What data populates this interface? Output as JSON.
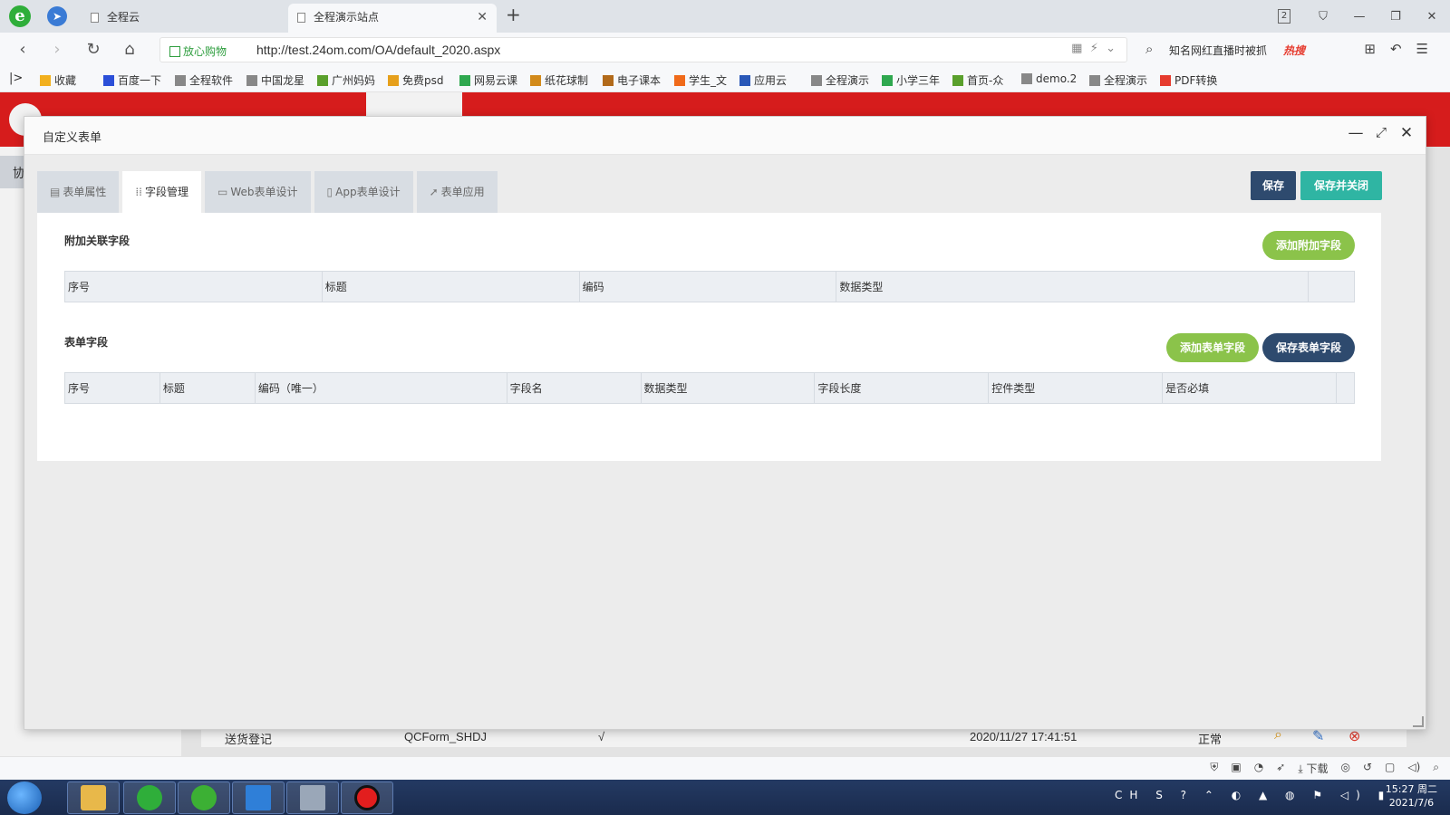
{
  "browser": {
    "tabs": [
      {
        "title": "全程云"
      },
      {
        "title": "全程演示站点"
      }
    ],
    "tab_count_badge": "2",
    "address": {
      "secure_label": "放心购物",
      "url": "http://test.24om.com/OA/default_2020.aspx"
    },
    "search": {
      "hint": "知名网红直播时被抓",
      "hot_label": "热搜"
    },
    "bookmarks": [
      {
        "label": "收藏",
        "icon": "star-icon",
        "color": "#f2b01e"
      },
      {
        "label": "百度一下",
        "icon": "baidu-icon",
        "color": "#2b4fd8"
      },
      {
        "label": "全程软件",
        "icon": "page-icon",
        "color": "#888888"
      },
      {
        "label": "中国龙星",
        "icon": "page-icon",
        "color": "#888888"
      },
      {
        "label": "广州妈妈",
        "icon": "leaf-icon",
        "color": "#5aa02c"
      },
      {
        "label": "免费psd",
        "icon": "eye-icon",
        "color": "#e6a01c"
      },
      {
        "label": "网易云课",
        "icon": "book-icon",
        "color": "#2fa84f"
      },
      {
        "label": "纸花球制",
        "icon": "globe-icon",
        "color": "#d28a1a"
      },
      {
        "label": "电子课本",
        "icon": "book-icon",
        "color": "#b26a1a"
      },
      {
        "label": "学生_文",
        "icon": "90-icon",
        "color": "#f06a1a"
      },
      {
        "label": "应用云",
        "icon": "cloud-icon",
        "color": "#2a58b8"
      },
      {
        "label": "全程演示",
        "icon": "page-icon",
        "color": "#888888"
      },
      {
        "label": "小学三年",
        "icon": "book-icon",
        "color": "#2fa84f"
      },
      {
        "label": "首页-众",
        "icon": "pen-icon",
        "color": "#5aa02c"
      },
      {
        "label": "demo.2",
        "icon": "page-icon",
        "color": "#888888"
      },
      {
        "label": "全程演示",
        "icon": "page-icon",
        "color": "#888888"
      },
      {
        "label": "PDF转换",
        "icon": "pdf-icon",
        "color": "#e63b2e"
      }
    ],
    "status_items": [
      "下载"
    ]
  },
  "background_row": {
    "name": "送货登记",
    "code": "QCForm_SHDJ",
    "check": "√",
    "datetime": "2020/11/27 17:41:51",
    "status": "正常"
  },
  "modal": {
    "title": "自定义表单",
    "tabs": [
      {
        "label": "表单属性",
        "icon": "document-icon",
        "glyph": "▤"
      },
      {
        "label": "字段管理",
        "icon": "grid-dots-icon",
        "glyph": "⁞⁞"
      },
      {
        "label": "Web表单设计",
        "icon": "monitor-icon",
        "glyph": "▭"
      },
      {
        "label": "App表单设计",
        "icon": "phone-icon",
        "glyph": "▯"
      },
      {
        "label": "表单应用",
        "icon": "paper-plane-icon",
        "glyph": "➚"
      }
    ],
    "active_tab": "字段管理",
    "buttons": {
      "save": "保存",
      "save_close": "保存并关闭"
    },
    "linked_fields": {
      "title": "附加关联字段",
      "add_button": "添加附加字段",
      "columns": [
        "序号",
        "标题",
        "编码",
        "数据类型",
        ""
      ]
    },
    "form_fields": {
      "title": "表单字段",
      "add_button": "添加表单字段",
      "save_button": "保存表单字段",
      "columns": [
        "序号",
        "标题",
        "编码（唯一）",
        "字段名",
        "数据类型",
        "字段长度",
        "控件类型",
        "是否必填",
        ""
      ]
    }
  },
  "taskbar": {
    "clock_time": "15:27 周二",
    "clock_date": "2021/7/6",
    "input_lang": "CH"
  },
  "colors": {
    "header_red": "#e21e1e",
    "navy_button": "#2e4a6e",
    "teal_button": "#2fb5a3",
    "green_pill": "#8bc34a"
  }
}
